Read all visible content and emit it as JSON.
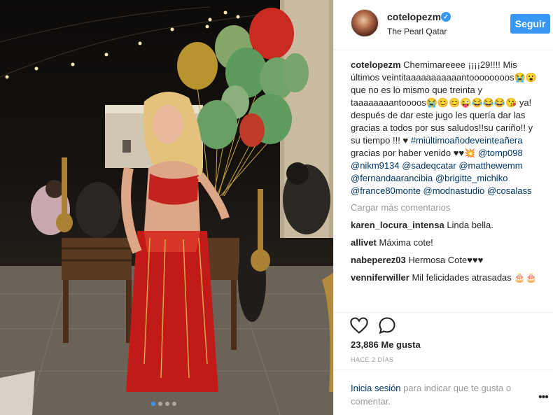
{
  "post": {
    "username": "cotelopezm",
    "location": "The Pearl Qatar",
    "follow_label": "Seguir",
    "verified_icon": "checkmark-icon"
  },
  "caption": {
    "author": "cotelopezm",
    "text": "Chemimareeee ¡¡¡¡29!!!! Mis últimos veintitaaaaaaaaaaantoooooooos😭😮 que no es lo mismo que treinta y taaaaaaaantoooos😭😊😊😜😂😂😂😘 ya! después de dar este jugo les quería dar las gracias a todos por sus saludos!!su cariño!! y su tiempo !!! ♥",
    "hashtag": "#miúltimoañodeveinteañera",
    "text2": "gracias por haber venido ♥♥💥",
    "mentions": [
      "@tomp098",
      "@nikm9134",
      "@sadeqcatar",
      "@matthewemm",
      "@fernandaarancibia",
      "@brigitte_michiko",
      "@france80monte",
      "@modnastudio",
      "@cosalass"
    ]
  },
  "load_more": "Cargar más comentarios",
  "comments": [
    {
      "user": "karen_locura_intensa",
      "text": "Linda bella."
    },
    {
      "user": "allivet",
      "text": "Máxima cote!"
    },
    {
      "user": "nabeperez03",
      "text": "Hermosa Cote♥♥♥"
    },
    {
      "user": "venniferwiller",
      "text": "Mil felicidades atrasadas 🎂🎂"
    }
  ],
  "actions": {
    "like_icon": "heart-icon",
    "comment_icon": "comment-icon"
  },
  "likes": "23,886 Me gusta",
  "timestamp": "HACE 2 DÍAS",
  "footer": {
    "login_link": "Inicia sesión",
    "login_text": " para indicar que te gusta o comentar.",
    "more_icon": "more-options-icon"
  },
  "carousel": {
    "count": 4,
    "active": 1
  },
  "colors": {
    "accent": "#3897f0",
    "link": "#003569",
    "muted": "#999999"
  }
}
